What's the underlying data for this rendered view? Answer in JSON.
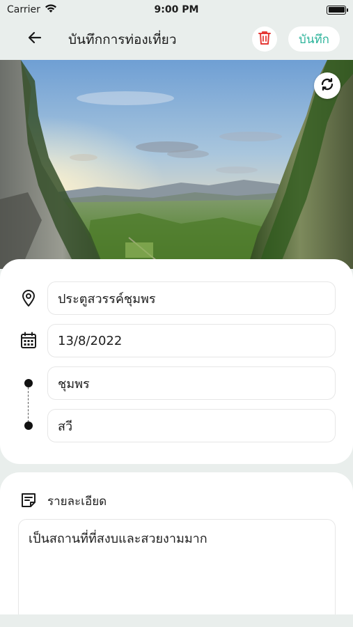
{
  "status_bar": {
    "carrier": "Carrier",
    "time": "9:00 PM",
    "battery_level": 1.0
  },
  "nav": {
    "title": "บันทึกการท่องเที่ยว",
    "save_label": "บันทึก",
    "back_icon": "arrow-left-icon",
    "delete_icon": "trash-icon"
  },
  "hero": {
    "refresh_icon": "refresh-icon"
  },
  "form": {
    "place": "ประตูสวรรค์ชุมพร",
    "date": "13/8/2022",
    "from": "ชุมพร",
    "to": "สวี"
  },
  "details": {
    "label": "รายละเอียด",
    "text": "เป็นสถานที่ที่สงบและสวยงามมาก"
  },
  "colors": {
    "accent": "#2bb39a",
    "delete": "#e53935",
    "background": "#e9eeec"
  }
}
